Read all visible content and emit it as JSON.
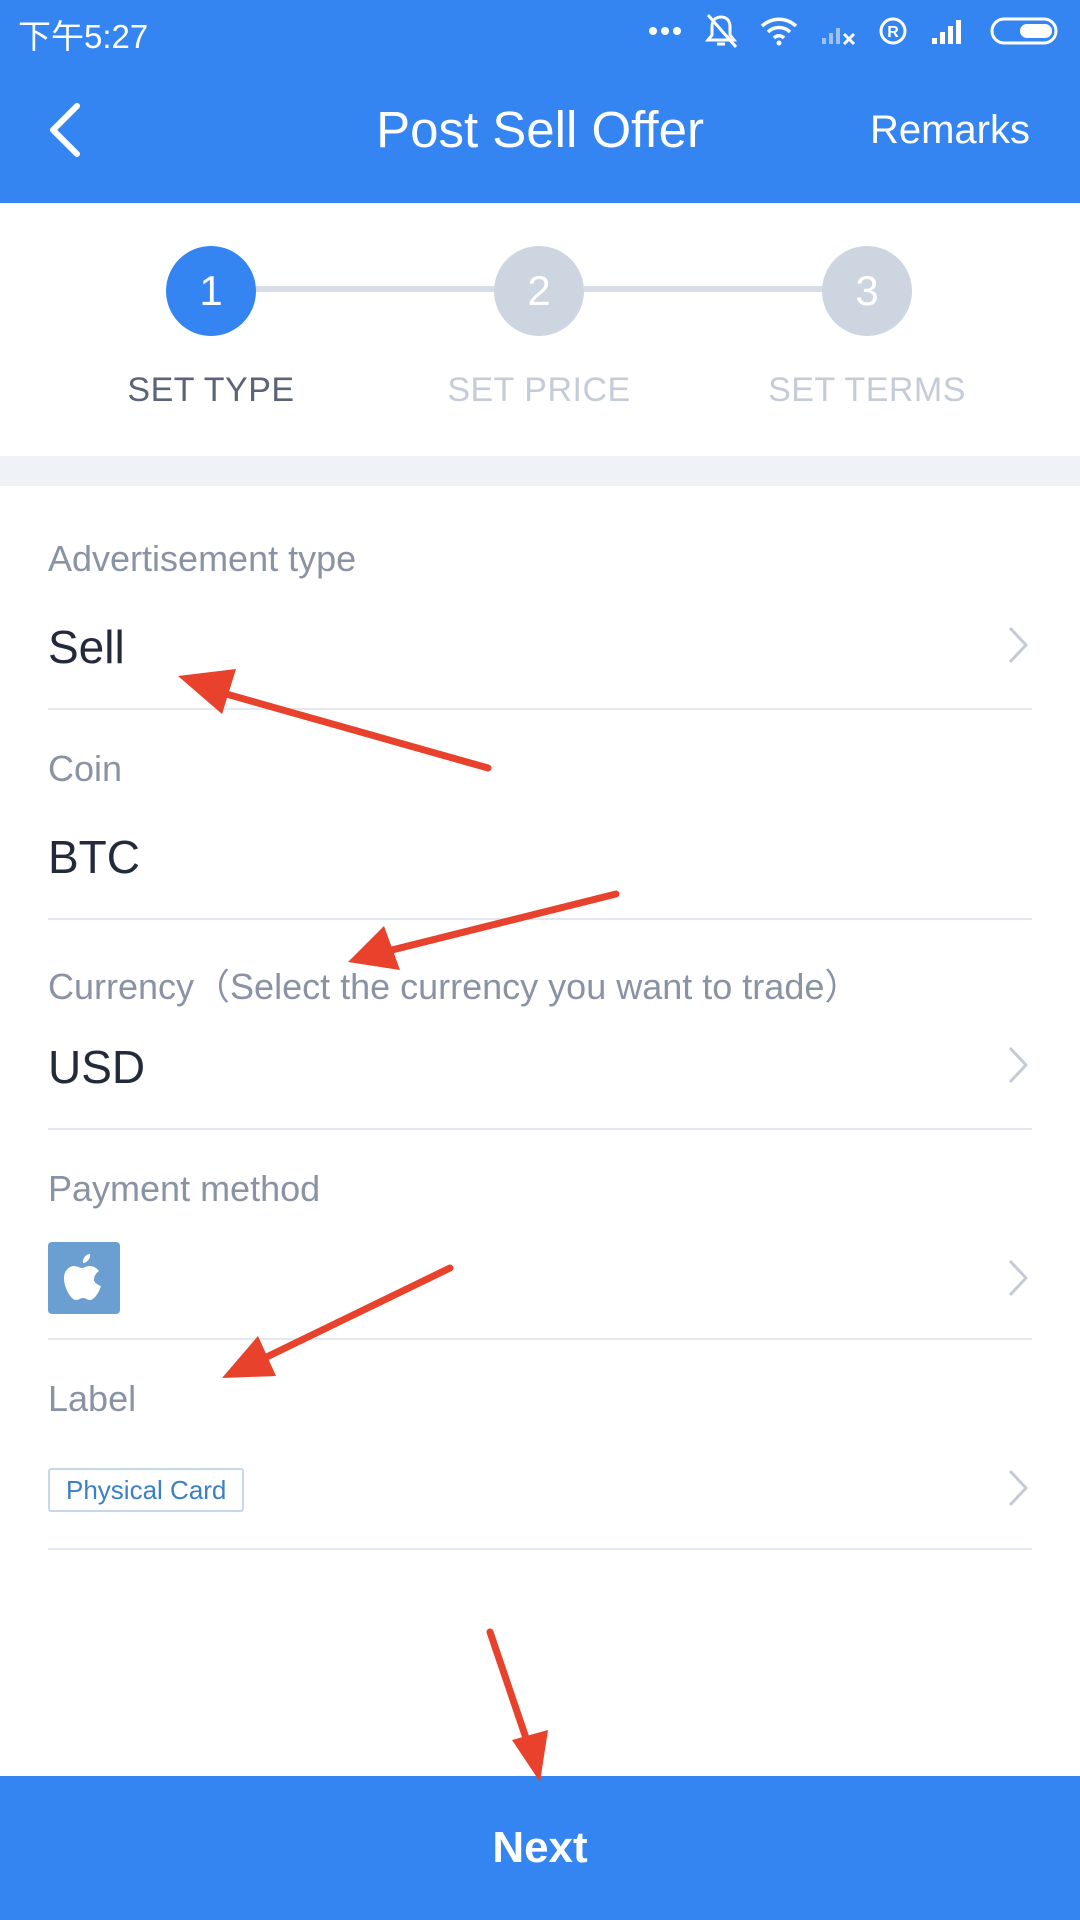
{
  "status_bar": {
    "time": "下午5:27"
  },
  "header": {
    "title": "Post Sell Offer",
    "remarks_label": "Remarks"
  },
  "stepper": {
    "steps": [
      {
        "number": "1",
        "label": "SET TYPE",
        "active": true
      },
      {
        "number": "2",
        "label": "SET PRICE",
        "active": false
      },
      {
        "number": "3",
        "label": "SET TERMS",
        "active": false
      }
    ]
  },
  "form": {
    "ad_type": {
      "label": "Advertisement type",
      "value": "Sell"
    },
    "coin": {
      "label": "Coin",
      "value": "BTC"
    },
    "currency": {
      "label": "Currency（Select the currency you want to trade）",
      "value": "USD"
    },
    "payment": {
      "label": "Payment method",
      "icon": "apple-icon"
    },
    "tag": {
      "label": "Label",
      "value": "Physical Card"
    }
  },
  "footer": {
    "next_label": "Next"
  },
  "colors": {
    "primary": "#3485f1",
    "inactive_step": "#cdd5e0",
    "annotation_arrow": "#e8412c"
  }
}
